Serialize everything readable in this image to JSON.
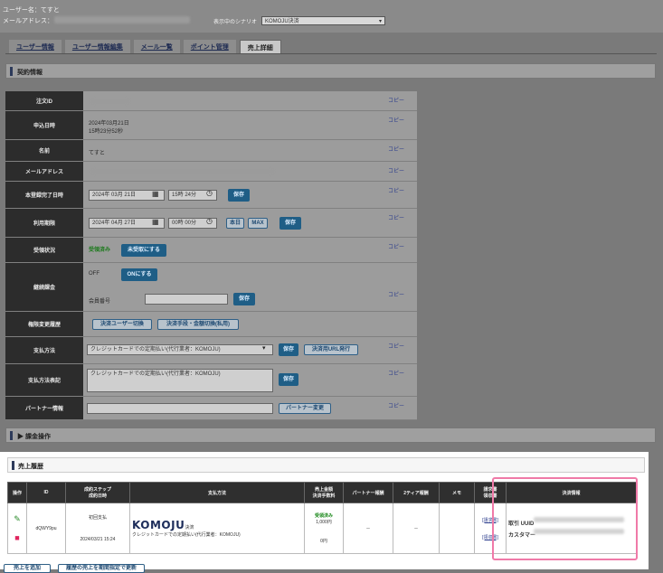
{
  "header": {
    "user_name_line": "ユーザー名：てすと",
    "email_label": "メールアドレス：",
    "scenario_label": "表示中のシナリオ",
    "scenario_value": "KOMOJU決済"
  },
  "tabs": [
    {
      "label": "ユーザー情報"
    },
    {
      "label": "ユーザー情報編集"
    },
    {
      "label": "メール一覧"
    },
    {
      "label": "ポイント管理"
    },
    {
      "label": "売上詳細"
    }
  ],
  "contract": {
    "title": "契約情報",
    "copy_label": "コピー",
    "rows": {
      "order_id": {
        "label": "注文ID"
      },
      "applied_at": {
        "label": "申込日時",
        "date": "2024年03月21日",
        "time": "15時23分52秒"
      },
      "name": {
        "label": "名前",
        "value": "てすと"
      },
      "email": {
        "label": "メールアドレス"
      },
      "expiry": {
        "label": "本登録完了日時",
        "date": "2024年 03月 21日",
        "time": "15時 24分",
        "save": "保存"
      },
      "usage_period": {
        "label": "利用期限",
        "date": "2024年 04月 27日",
        "time": "00時 00分",
        "opt1": "本日",
        "opt2": "MAX",
        "save": "保存"
      },
      "status": {
        "label": "受領状況",
        "value": "受領済み",
        "button": "未受取にする"
      },
      "recurring": {
        "label": "継続課金",
        "state": "OFF",
        "button": "ONにする",
        "card_label": "会員番号",
        "save": "保存"
      },
      "authority": {
        "label": "権限変更履歴",
        "btn1": "決済ユーザー切換",
        "btn2": "決済手段・金額切換(私用)"
      },
      "payment_method": {
        "label": "支払方法",
        "select": "クレジットカードでの定期払い(代行業者：KOMOJU)",
        "save": "保存",
        "btn": "決済用URL発行"
      },
      "payment_note": {
        "label": "支払方法表記",
        "value": "クレジットカードでの定期払い(代行業者：KOMOJU)",
        "save": "保存"
      },
      "partner": {
        "label": "パートナー情報",
        "button": "パートナー変更"
      }
    }
  },
  "billing": {
    "title": "課金操作"
  },
  "sales": {
    "title": "売上履歴",
    "columns": [
      "操作",
      "ID",
      "成約ステップ\n成約日時",
      "支払方法",
      "売上金額\n決済手数料",
      "パートナー報酬",
      "2ティア報酬",
      "メモ",
      "請求書\n領収書",
      "決済情報"
    ],
    "row": {
      "id": "dQWY9pu",
      "step": "初回支払",
      "closed_at": "2024/03/21 15:24",
      "method_logo": "KOMOJU",
      "method_suffix": "決済",
      "method_text": "クレジットカードでの定期払い(代行業者：KOMOJU)",
      "status": "受領済み",
      "amount": "1,000円",
      "fee": "0円",
      "partner_dash": "－",
      "tier_dash": "－",
      "invoice": "[請求書]",
      "receipt": "[領収書]",
      "uuid_label": "取引 UUID",
      "customer_label": "カスタマー"
    }
  },
  "footer": {
    "btn1": "売上を追加",
    "btn2": "履歴の売上を期間指定で更新"
  },
  "colors": {
    "highlight": "#f07aa8",
    "dark_label": "#2c2c2c",
    "primary_btn": "#1f5e86"
  }
}
